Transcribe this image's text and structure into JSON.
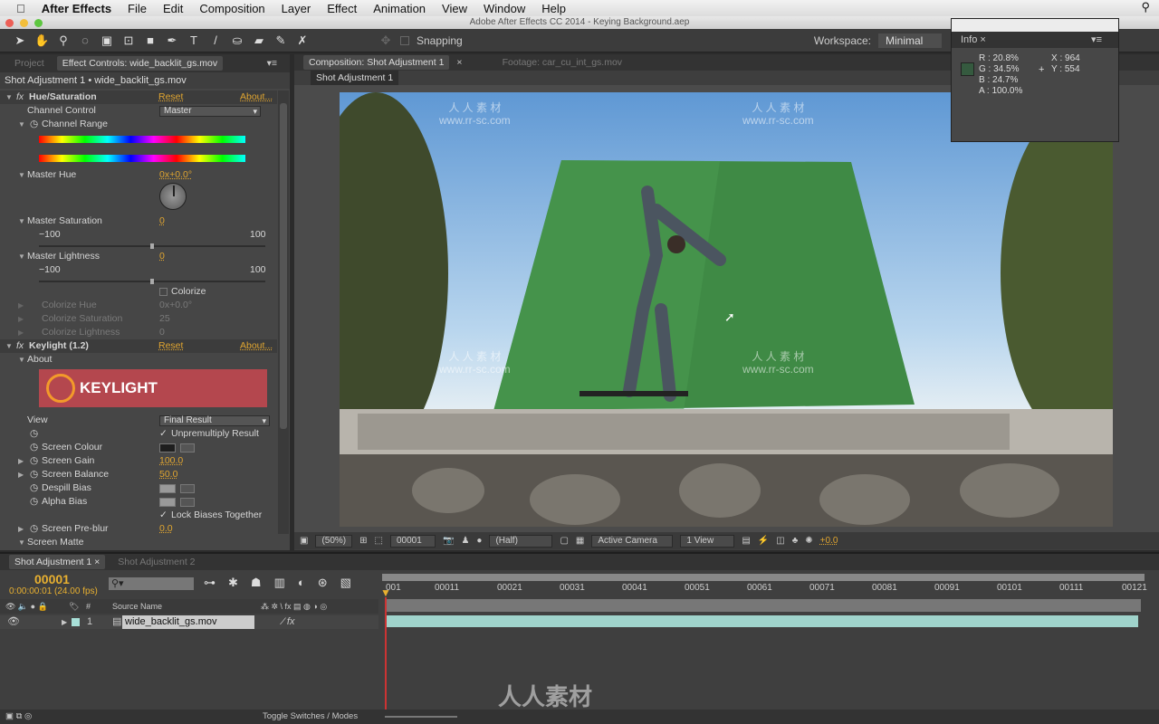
{
  "menubar": {
    "app": "After Effects",
    "items": [
      "File",
      "Edit",
      "Composition",
      "Layer",
      "Effect",
      "Animation",
      "View",
      "Window",
      "Help"
    ]
  },
  "window_title": "Adobe After Effects CC 2014 - Keying Background.aep",
  "toolbar": {
    "snapping": "Snapping",
    "workspace_label": "Workspace:",
    "workspace_value": "Minimal"
  },
  "left_panel": {
    "tabs": [
      "Project",
      "Effect Controls: wide_backlit_gs.mov"
    ],
    "header": "Shot Adjustment 1 • wide_backlit_gs.mov",
    "hue_sat": {
      "name": "Hue/Saturation",
      "reset": "Reset",
      "about": "About...",
      "channel_control": "Channel Control",
      "channel_value": "Master",
      "channel_range": "Channel Range",
      "master_hue": "Master Hue",
      "master_hue_val": "0x+0.0°",
      "master_sat": "Master Saturation",
      "master_sat_val": "0",
      "min": "−100",
      "max": "100",
      "master_light": "Master Lightness",
      "master_light_val": "0",
      "colorize": "Colorize",
      "colorize_hue": "Colorize Hue",
      "colorize_hue_val": "0x+0.0°",
      "colorize_sat": "Colorize Saturation",
      "colorize_sat_val": "25",
      "colorize_light": "Colorize Lightness",
      "colorize_light_val": "0"
    },
    "keylight": {
      "name": "Keylight (1.2)",
      "reset": "Reset",
      "about_link": "About...",
      "about": "About",
      "logo": "KEYLIGHT",
      "view": "View",
      "view_value": "Final Result",
      "unpremultiply": "Unpremultiply Result",
      "screen_colour": "Screen Colour",
      "screen_gain": "Screen Gain",
      "screen_gain_val": "100.0",
      "screen_balance": "Screen Balance",
      "screen_balance_val": "50.0",
      "despill": "Despill Bias",
      "alpha_bias": "Alpha Bias",
      "lock_biases": "Lock Biases Together",
      "pre_blur": "Screen Pre-blur",
      "pre_blur_val": "0.0",
      "screen_matte": "Screen Matte",
      "screen_colour_hex": "#1e1e1e"
    }
  },
  "comp_panel": {
    "tabs": [
      "Composition: Shot Adjustment 1",
      "Footage: car_cu_int_gs.mov"
    ],
    "subtab": "Shot Adjustment 1",
    "bar": {
      "zoom": "(50%)",
      "frame": "00001",
      "resolution": "(Half)",
      "camera": "Active Camera",
      "views": "1 View",
      "exposure": "+0.0"
    }
  },
  "info": {
    "title": "Info",
    "r": "R : 20.8%",
    "g": "G : 34.5%",
    "b": "B : 24.7%",
    "a": "A : 100.0%",
    "x": "X : 964",
    "y": "Y : 554",
    "swatch": "#355a3f"
  },
  "timeline": {
    "tabs": [
      "Shot Adjustment 1",
      "Shot Adjustment 2"
    ],
    "timecode": "00001",
    "timecode_sub": "0:00:00:01 (24.00 fps)",
    "col_hash": "#",
    "col_source": "Source Name",
    "layer_num": "1",
    "layer_name": "wide_backlit_gs.mov",
    "ticks": [
      "00011",
      "00021",
      "00031",
      "00041",
      "00051",
      "00061",
      "00071",
      "00081",
      "00091",
      "00101",
      "00111",
      "00121"
    ],
    "first_tick": "001",
    "toggle": "Toggle Switches / Modes"
  },
  "watermark": {
    "cn": "人 人 素 材",
    "url": "www.rr-sc.com",
    "logo": "人人素材"
  }
}
